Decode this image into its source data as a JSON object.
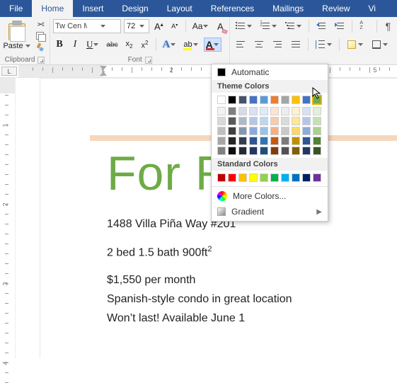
{
  "tabs": [
    "File",
    "Home",
    "Insert",
    "Design",
    "Layout",
    "References",
    "Mailings",
    "Review",
    "Vi"
  ],
  "active_tab": 1,
  "groups": {
    "clipboard": "Clipboard",
    "font": "Font"
  },
  "clipboard": {
    "paste": "Paste"
  },
  "font": {
    "name": "Tw Cen MT Co",
    "size": "72",
    "bold": "B",
    "italic": "I",
    "underline": "U",
    "x2": "x",
    "aa": "Aa",
    "abc": "abc",
    "A": "A"
  },
  "ruler": {
    "corner": "L",
    "numbers": [
      "1",
      "2",
      "3",
      "4",
      "5"
    ]
  },
  "popup": {
    "automatic": "Automatic",
    "theme_hdr": "Theme Colors",
    "std_hdr": "Standard Colors",
    "more": "More Colors...",
    "gradient": "Gradient",
    "theme_row": [
      "#ffffff",
      "#000000",
      "#44546a",
      "#4472c4",
      "#5b9bd5",
      "#ed7d31",
      "#a5a5a5",
      "#ffc000",
      "#4472c4",
      "#70ad47"
    ],
    "theme_shades": [
      [
        "#f2f2f2",
        "#7f7f7f",
        "#d6dce5",
        "#d9e1f2",
        "#deebf7",
        "#fbe5d6",
        "#ededed",
        "#fff2cc",
        "#d9e1f2",
        "#e2efda"
      ],
      [
        "#d9d9d9",
        "#595959",
        "#adb9ca",
        "#b4c6e7",
        "#bdd7ee",
        "#f8cbad",
        "#dbdbdb",
        "#ffe699",
        "#b4c6e7",
        "#c6e0b4"
      ],
      [
        "#bfbfbf",
        "#404040",
        "#8497b0",
        "#8ea9db",
        "#9bc2e6",
        "#f4b084",
        "#c9c9c9",
        "#ffd966",
        "#8ea9db",
        "#a9d08e"
      ],
      [
        "#a6a6a6",
        "#262626",
        "#333f4f",
        "#305496",
        "#2f75b5",
        "#c65911",
        "#7b7b7b",
        "#bf8f00",
        "#305496",
        "#548235"
      ],
      [
        "#808080",
        "#0d0d0d",
        "#222b35",
        "#203764",
        "#1f4e78",
        "#833c0c",
        "#525252",
        "#806000",
        "#203764",
        "#375623"
      ]
    ],
    "standard": [
      "#c00000",
      "#ff0000",
      "#ffc000",
      "#ffff00",
      "#92d050",
      "#00b050",
      "#00b0f0",
      "#0070c0",
      "#002060",
      "#7030a0"
    ],
    "hover_index": 9
  },
  "doc": {
    "title": "For Rent",
    "addr": "1488 Villa Piña Way #201",
    "l1a": "2 bed 1.5 bath 900ft",
    "l1b": "2",
    "l2": "$1,550 per month",
    "l3": "Spanish-style condo in great location",
    "l4": "Won’t last! Available June 1"
  }
}
